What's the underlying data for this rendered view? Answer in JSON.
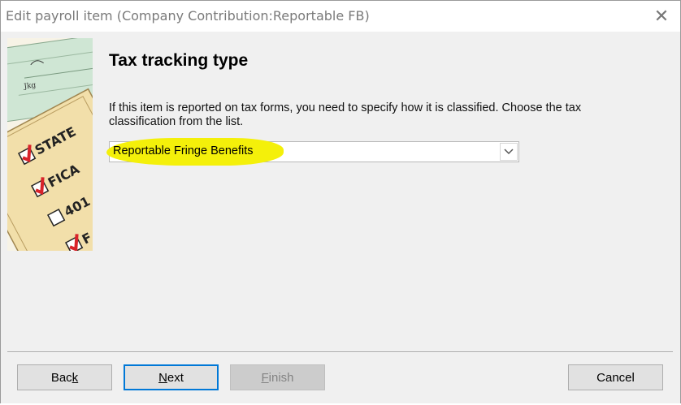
{
  "window": {
    "title": "Edit payroll item (Company Contribution:Reportable FB)",
    "close_glyph": "✕"
  },
  "main": {
    "heading": "Tax tracking type",
    "description": "If this item is reported on tax forms, you need to specify how it is classified. Choose the tax classification from the list.",
    "tax_type": {
      "value": "Reportable Fringe Benefits",
      "highlight_color": "#f4f00a"
    }
  },
  "illustration": {
    "checkbox_labels": [
      "STATE",
      "FICA",
      "401",
      "F"
    ],
    "check_colors": {
      "check": "#d8232a",
      "paper": "#f5e6b8",
      "form": "#cfe6d4"
    }
  },
  "buttons": {
    "back": {
      "pre": "Bac",
      "key": "k",
      "post": ""
    },
    "next": {
      "pre": "",
      "key": "N",
      "post": "ext"
    },
    "finish": {
      "pre": "",
      "key": "F",
      "post": "inish"
    },
    "cancel": {
      "label": "Cancel"
    }
  },
  "icons": {
    "close": "close-icon",
    "dropdown": "chevron-down-icon",
    "illustration": "tax-forms-illustration"
  }
}
